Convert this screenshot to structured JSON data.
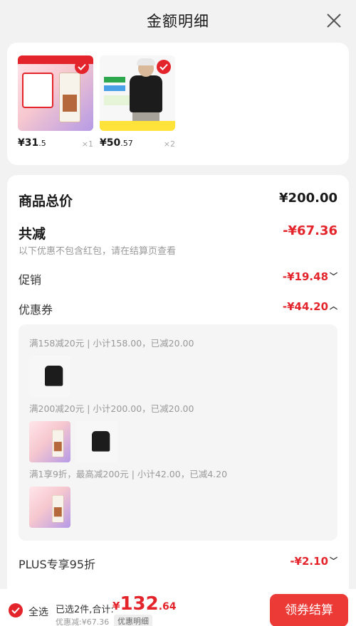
{
  "header": {
    "title": "金额明细",
    "close_icon": "close-icon"
  },
  "products": [
    {
      "price_int": "¥31",
      "price_dec": ".5",
      "qty": "×1",
      "checked": true
    },
    {
      "price_int": "¥50",
      "price_dec": ".57",
      "qty": "×2",
      "checked": true
    }
  ],
  "summary": {
    "total_label": "商品总价",
    "total_value": "¥200.00",
    "reduce_label": "共减",
    "reduce_value": "-¥67.36",
    "note": "以下优惠不包含红包，请在结算页查看",
    "promo_label": "促销",
    "promo_value": "-¥19.48",
    "coupon_label": "优惠券",
    "coupon_value": "-¥44.20",
    "plus_label": "PLUS专享95折",
    "plus_value": "-¥2.10"
  },
  "coupons": [
    {
      "text": "满158减20元 | 小计158.00，已减20.00"
    },
    {
      "text": "满200减20元 | 小计200.00，已减20.00"
    },
    {
      "text": "满1享9折，最高减200元 | 小计42.00，已减4.20"
    }
  ],
  "bottom": {
    "select_all": "全选",
    "selected": "已选2件,合计:",
    "total_yen": "¥",
    "total_int": "132",
    "total_dec": ".64",
    "saved": "优惠减:¥67.36",
    "detail_tag": "优惠明细",
    "checkout": "领券结算"
  },
  "colors": {
    "accent": "#e3242b",
    "button": "#ec3a36"
  }
}
